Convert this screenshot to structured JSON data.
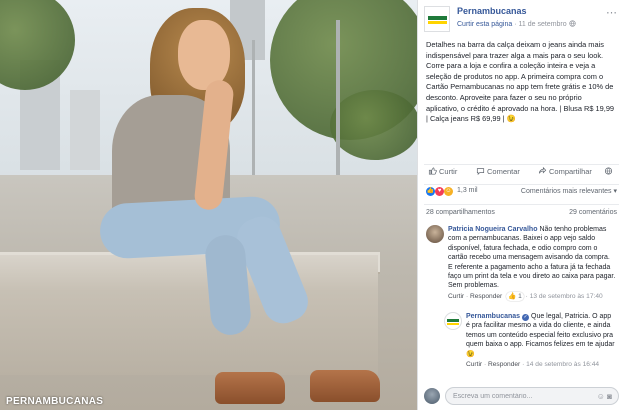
{
  "photo": {
    "watermark": "PERNAMBUCANAS"
  },
  "post": {
    "page_name": "Pernambucanas",
    "sponsored": "Curtir esta página",
    "separator": "·",
    "date": "11 de setembro",
    "caption": "Detalhes na barra da calça deixam o jeans ainda mais indispensável para trazer alga a mais para o seu look. Corre para a loja e confira a coleção inteira e veja a seleção de produtos no app. A primeira compra com o Cartão Pernambucanas no app tem frete grátis e 10% de desconto. Aproveite para fazer o seu no próprio aplicativo, o crédito é aprovado na hora. | Blusa R$ 19,99 | Calça jeans R$ 69,99 | 😉"
  },
  "actions": {
    "like": "Curtir",
    "comment": "Comentar",
    "share": "Compartilhar"
  },
  "reactions": {
    "count": "1,3 mil",
    "sort": "Comentários mais relevantes ▾"
  },
  "shares": {
    "shares": "28 compartilhamentos",
    "comments": "29 comentários"
  },
  "comments": [
    {
      "author": "Patricia Nogueira Carvalho",
      "text": "Não tenho problemas com a pernambucanas. Baixei o app vejo saldo disponível, fatura fechada, e odio compro com o cartão recebo uma mensagem avisando da compra. E referente a pagamento acho a fatura já ta fechada faço um print da tela e vou direto ao caixa para pagar. Sem problemas.",
      "like": "Curtir",
      "reply": "Responder",
      "likes": "1",
      "time": "13 de setembro às 17:40"
    },
    {
      "author": "Pernambucanas",
      "text": "Que legal, Patricia. O app é pra facilitar mesmo a vida do cliente, e ainda temos um conteúdo especial feito exclusivo pra quem baixa o app. Ficamos felizes em te ajudar 😉",
      "like": "Curtir",
      "reply": "Responder",
      "time": "14 de setembro às 16:44"
    }
  ],
  "composer": {
    "placeholder": "Escreva um comentário..."
  },
  "colors": {
    "brand_link": "#365899",
    "like_blue": "#1877f2",
    "love_red": "#f33e58",
    "haha_yellow": "#f7b125"
  }
}
